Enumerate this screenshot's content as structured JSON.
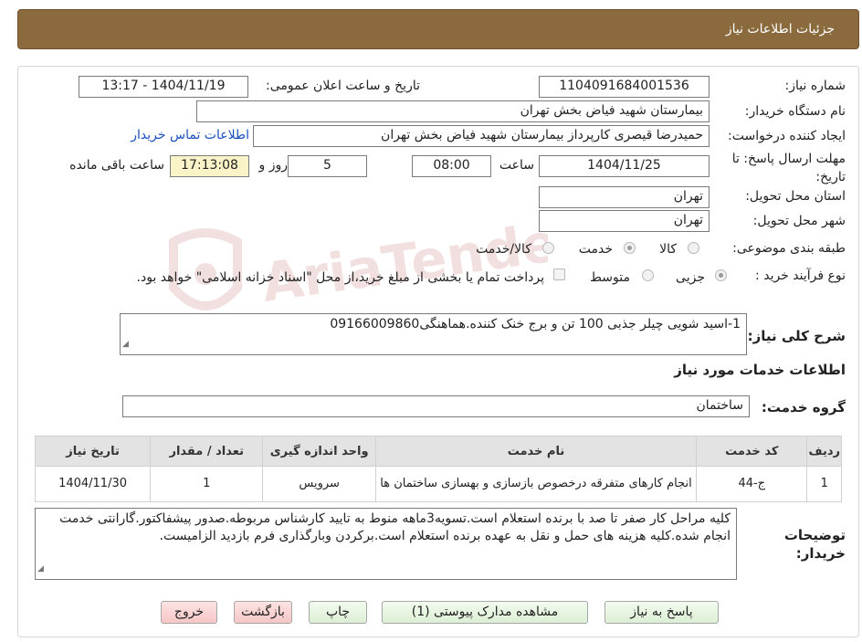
{
  "header": {
    "title": "جزئیات اطلاعات نیاز"
  },
  "need": {
    "number_label": "شماره نیاز:",
    "number": "1104091684001536",
    "announce_label": "تاریخ و ساعت اعلان عمومی:",
    "announce_value": "1404/11/19 - 13:17",
    "buyer_label": "نام دستگاه خریدار:",
    "buyer": "بیمارستان شهید فیاض بخش تهران",
    "requester_label": "ایجاد کننده درخواست:",
    "requester": "حمیدرضا قیصری کارپرداز بیمارستان شهید فیاض بخش تهران",
    "contact_link": "اطلاعات تماس خریدار",
    "deadline_label": "مهلت ارسال پاسخ: تا تاریخ:",
    "deadline_date": "1404/11/25",
    "time_label": "ساعت",
    "deadline_time": "08:00",
    "days": "5",
    "days_label": "روز و",
    "remaining": "17:13:08",
    "remaining_label": "ساعت باقی مانده",
    "province_label": "استان محل تحویل:",
    "province": "تهران",
    "city_label": "شهر محل تحویل:",
    "city": "تهران",
    "category_label": "طبقه بندی موضوعی:",
    "category_options": [
      "کالا",
      "خدمت",
      "کالا/خدمت"
    ],
    "category_selected": "خدمت",
    "process_label": "نوع فرآیند خرید :",
    "process_options": [
      "جزیی",
      "متوسط"
    ],
    "process_selected": "جزیی",
    "payment_note": "پرداخت تمام یا بخشی از مبلغ خرید،از محل \"اسناد خزانه اسلامی\" خواهد بود.",
    "summary_label": "شرح کلی نیاز:",
    "summary": "1-اسید شویی چیلر جذبی 100 تن و برج خنک کننده.هماهنگی09166009860"
  },
  "services": {
    "section_title": "اطلاعات خدمات مورد نیاز",
    "group_label": "گروه خدمت:",
    "group": "ساختمان",
    "columns": [
      "ردیف",
      "کد خدمت",
      "نام خدمت",
      "واحد اندازه گیری",
      "تعداد / مقدار",
      "تاریخ نیاز"
    ],
    "rows": [
      [
        "1",
        "ج-44",
        "انجام کارهای متفرقه درخصوص بازسازی و بهسازی ساختمان ها",
        "سرویس",
        "1",
        "1404/11/30"
      ]
    ]
  },
  "notes": {
    "label": "توضیحات خریدار:",
    "text": "کلیه مراحل کار صفر تا صد با برنده استعلام است.تسویه3ماهه منوط به تایید کارشناس مربوطه.صدور پیشفاکتور.گارانتی خدمت انجام شده.کلیه هزینه های حمل و نقل به عهده برنده استعلام است.برکردن وبارگذاری فرم بازدید الزامیست."
  },
  "buttons": {
    "reply": "پاسخ به نیاز",
    "attachments": "مشاهده مدارک پیوستی (1)",
    "print": "چاپ",
    "back": "بازگشت",
    "exit": "خروج"
  },
  "watermark": {
    "text": "AriaTender.neT"
  },
  "colors": {
    "header_bg": "#8B6A3E",
    "yellow_field": "#fbf3c8",
    "link": "#1a4fc0"
  }
}
